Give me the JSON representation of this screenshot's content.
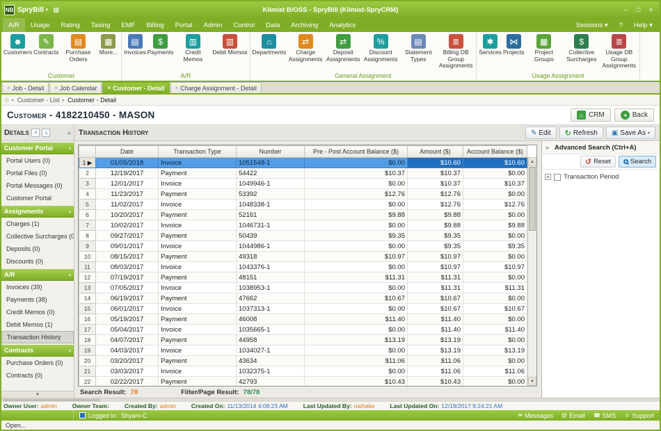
{
  "colors": {
    "brand_green": "#7fae26",
    "selection_blue": "#2276cc",
    "value_orange": "#e2790e",
    "value_blue": "#2d6ebb"
  },
  "titlebar": {
    "logo": "NB",
    "app_name": "SpryBill",
    "title": "Kilmist B/OSS - SpryBill (Kilmist-SpryCRM)"
  },
  "menubar": {
    "items": [
      "A/R",
      "Usage",
      "Rating",
      "Taxing",
      "EMF",
      "Billing",
      "Portal",
      "Admin",
      "Control",
      "Data",
      "Archiving",
      "Analytics"
    ],
    "right": [
      {
        "label": "Sessions",
        "arrow": true
      },
      {
        "label": "?",
        "arrow": false
      },
      {
        "label": "Help",
        "arrow": true
      }
    ]
  },
  "ribbon": {
    "groups": [
      {
        "label": "Customer",
        "items": [
          {
            "label": "Customers",
            "icon": "customers-icon"
          },
          {
            "label": "Contracts",
            "icon": "contracts-icon"
          },
          {
            "label": "Purchase Orders",
            "icon": "purchase-orders-icon"
          },
          {
            "label": "More...",
            "icon": "more-icon"
          }
        ]
      },
      {
        "label": "A/R",
        "items": [
          {
            "label": "Invoices",
            "icon": "invoices-icon"
          },
          {
            "label": "Payments",
            "icon": "payments-icon"
          },
          {
            "label": "Credit Memos",
            "icon": "credit-memos-icon"
          },
          {
            "label": "Debit Memos",
            "icon": "debit-memos-icon"
          }
        ]
      },
      {
        "label": "General Assignment",
        "items": [
          {
            "label": "Departments",
            "icon": "departments-icon"
          },
          {
            "label": "Charge Assignments",
            "icon": "charge-assignments-icon"
          },
          {
            "label": "Deposit Assignments",
            "icon": "deposit-assignments-icon"
          },
          {
            "label": "Discount Assignments",
            "icon": "discount-assignments-icon"
          },
          {
            "label": "Statement Types",
            "icon": "statement-types-icon"
          },
          {
            "label": "Billing DB Group Assignments",
            "icon": "billing-db-icon"
          }
        ]
      },
      {
        "label": "Usage Assignment",
        "items": [
          {
            "label": "Services",
            "icon": "services-icon"
          },
          {
            "label": "Projects",
            "icon": "projects-icon"
          },
          {
            "label": "Project Groups",
            "icon": "project-groups-icon"
          },
          {
            "label": "Collective Surcharges",
            "icon": "collective-surcharges-icon"
          },
          {
            "label": "Usage DB Group Assignments",
            "icon": "usage-db-icon"
          }
        ]
      }
    ]
  },
  "tabs": [
    {
      "label": "Job - Detail",
      "active": false
    },
    {
      "label": "Job Calendar",
      "active": false
    },
    {
      "label": "Customer - Detail",
      "active": true
    },
    {
      "label": "Charge Assignment - Detail",
      "active": false
    }
  ],
  "breadcrumb": {
    "items": [
      "Customer - List",
      "Customer - Detail"
    ]
  },
  "page": {
    "title": "Customer - 4182210450 - MASON",
    "crm_button": "CRM",
    "back_button": "Back"
  },
  "details_panel": {
    "title": "Details",
    "sections": [
      {
        "header": "Customer Portal",
        "items": [
          {
            "label": "Portal Users (0)"
          },
          {
            "label": "Portal Files (0)"
          },
          {
            "label": "Portal Messages (0)"
          },
          {
            "label": "Customer Portal"
          }
        ]
      },
      {
        "header": "Assignments",
        "items": [
          {
            "label": "Charges (1)"
          },
          {
            "label": "Collective Surcharges (0)"
          },
          {
            "label": "Deposits (0)"
          },
          {
            "label": "Discounts (0)"
          }
        ]
      },
      {
        "header": "A/R",
        "items": [
          {
            "label": "Invoices (39)"
          },
          {
            "label": "Payments (38)"
          },
          {
            "label": "Credit Memos (0)"
          },
          {
            "label": "Debit Memos (1)"
          },
          {
            "label": "Transaction History",
            "selected": true
          }
        ]
      },
      {
        "header": "Contracts",
        "items": [
          {
            "label": "Purchase Orders (0)"
          },
          {
            "label": "Contracts (0)"
          }
        ]
      }
    ]
  },
  "main": {
    "title": "Transaction History",
    "toolbar": {
      "edit": "Edit",
      "refresh": "Refresh",
      "save_as": "Save As"
    }
  },
  "table": {
    "columns": [
      "Date",
      "Transaction Type",
      "Number",
      "Pre - Post Account Balance ($)",
      "Amount ($)",
      "Account Balance ($)"
    ],
    "rows": [
      {
        "num": 1,
        "date": "01/05/2018",
        "type": "Invoice",
        "number": "1051548-1",
        "pre_post": "$0.00",
        "amount": "$10.60",
        "balance": "$10.60",
        "selected": true
      },
      {
        "num": 2,
        "date": "12/19/2017",
        "type": "Payment",
        "number": "54422",
        "pre_post": "$10.37",
        "amount": "$10.37",
        "balance": "$0.00"
      },
      {
        "num": 3,
        "date": "12/01/2017",
        "type": "Invoice",
        "number": "1049946-1",
        "pre_post": "$0.00",
        "amount": "$10.37",
        "balance": "$10.37"
      },
      {
        "num": 4,
        "date": "11/23/2017",
        "type": "Payment",
        "number": "53392",
        "pre_post": "$12.76",
        "amount": "$12.76",
        "balance": "$0.00"
      },
      {
        "num": 5,
        "date": "11/02/2017",
        "type": "Invoice",
        "number": "1048338-1",
        "pre_post": "$0.00",
        "amount": "$12.76",
        "balance": "$12.76"
      },
      {
        "num": 6,
        "date": "10/20/2017",
        "type": "Payment",
        "number": "52161",
        "pre_post": "$9.88",
        "amount": "$9.88",
        "balance": "$0.00"
      },
      {
        "num": 7,
        "date": "10/02/2017",
        "type": "Invoice",
        "number": "1046731-1",
        "pre_post": "$0.00",
        "amount": "$9.88",
        "balance": "$9.88"
      },
      {
        "num": 8,
        "date": "09/27/2017",
        "type": "Payment",
        "number": "50439",
        "pre_post": "$9.35",
        "amount": "$9.35",
        "balance": "$0.00"
      },
      {
        "num": 9,
        "date": "09/01/2017",
        "type": "Invoice",
        "number": "1044986-1",
        "pre_post": "$0.00",
        "amount": "$9.35",
        "balance": "$9.35"
      },
      {
        "num": 10,
        "date": "08/15/2017",
        "type": "Payment",
        "number": "49318",
        "pre_post": "$10.97",
        "amount": "$10.97",
        "balance": "$0.00"
      },
      {
        "num": 11,
        "date": "08/03/2017",
        "type": "Invoice",
        "number": "1043376-1",
        "pre_post": "$0.00",
        "amount": "$10.97",
        "balance": "$10.97"
      },
      {
        "num": 12,
        "date": "07/19/2017",
        "type": "Payment",
        "number": "48151",
        "pre_post": "$11.31",
        "amount": "$11.31",
        "balance": "$0.00"
      },
      {
        "num": 13,
        "date": "07/05/2017",
        "type": "Invoice",
        "number": "1038953-1",
        "pre_post": "$0.00",
        "amount": "$11.31",
        "balance": "$11.31"
      },
      {
        "num": 14,
        "date": "06/19/2017",
        "type": "Payment",
        "number": "47662",
        "pre_post": "$10.67",
        "amount": "$10.67",
        "balance": "$0.00"
      },
      {
        "num": 15,
        "date": "06/01/2017",
        "type": "Invoice",
        "number": "1037313-1",
        "pre_post": "$0.00",
        "amount": "$10.67",
        "balance": "$10.67"
      },
      {
        "num": 16,
        "date": "05/19/2017",
        "type": "Payment",
        "number": "46008",
        "pre_post": "$11.40",
        "amount": "$11.40",
        "balance": "$0.00"
      },
      {
        "num": 17,
        "date": "05/04/2017",
        "type": "Invoice",
        "number": "1035665-1",
        "pre_post": "$0.00",
        "amount": "$11.40",
        "balance": "$11.40"
      },
      {
        "num": 18,
        "date": "04/07/2017",
        "type": "Payment",
        "number": "44958",
        "pre_post": "$13.19",
        "amount": "$13.19",
        "balance": "$0.00"
      },
      {
        "num": 19,
        "date": "04/03/2017",
        "type": "Invoice",
        "number": "1034027-1",
        "pre_post": "$0.00",
        "amount": "$13.19",
        "balance": "$13.19"
      },
      {
        "num": 20,
        "date": "03/20/2017",
        "type": "Payment",
        "number": "43634",
        "pre_post": "$11.06",
        "amount": "$11.06",
        "balance": "$0.00"
      },
      {
        "num": 21,
        "date": "03/03/2017",
        "type": "Invoice",
        "number": "1032375-1",
        "pre_post": "$0.00",
        "amount": "$11.06",
        "balance": "$11.06"
      },
      {
        "num": 22,
        "date": "02/22/2017",
        "type": "Payment",
        "number": "42793",
        "pre_post": "$10.43",
        "amount": "$10.43",
        "balance": "$0.00"
      }
    ]
  },
  "results": {
    "search_label": "Search Result:",
    "search_value": "78",
    "filter_label": "Filter/Page Result:",
    "filter_value": "78/78"
  },
  "advanced_search": {
    "title": "Advanced Search (Ctrl+A)",
    "reset": "Reset",
    "search": "Search",
    "filters": [
      {
        "label": "Transaction Period"
      }
    ]
  },
  "footer": {
    "fields": [
      {
        "label": "Owner User:",
        "value": "admin",
        "type": "name"
      },
      {
        "label": "Owner Team:",
        "value": "",
        "type": "name"
      },
      {
        "label": "Created By:",
        "value": "admin",
        "type": "name"
      },
      {
        "label": "Created On:",
        "value": "11/13/2014 4:08:23 AM",
        "type": "date"
      },
      {
        "label": "Last Updated By:",
        "value": "nathalie",
        "type": "name"
      },
      {
        "label": "Last Updated On:",
        "value": "12/19/2017 9:24:21 AM",
        "type": "date"
      }
    ]
  },
  "statusbar": {
    "logged_in": "Logged in : Shyam-C",
    "right": [
      "Messages",
      "Email",
      "SMS",
      "Support"
    ]
  },
  "openbar": {
    "label": "Open..."
  }
}
